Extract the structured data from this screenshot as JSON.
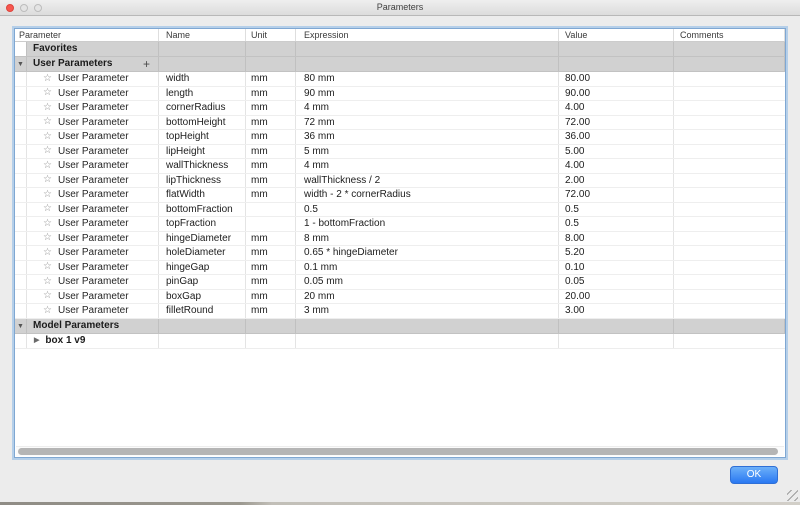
{
  "window": {
    "title": "Parameters"
  },
  "icons": {
    "favorite_star": "☆",
    "add": "+",
    "collapse": "▼",
    "expand": "▶"
  },
  "table": {
    "columns": [
      "Parameter",
      "Name",
      "Unit",
      "Expression",
      "Value",
      "Comments"
    ],
    "favorites": {
      "label": "Favorites"
    },
    "user_parameters": {
      "label": "User Parameters"
    },
    "rows": [
      {
        "parameter": "User Parameter",
        "name": "width",
        "unit": "mm",
        "expression": "80 mm",
        "value": "80.00",
        "comments": ""
      },
      {
        "parameter": "User Parameter",
        "name": "length",
        "unit": "mm",
        "expression": "90 mm",
        "value": "90.00",
        "comments": ""
      },
      {
        "parameter": "User Parameter",
        "name": "cornerRadius",
        "unit": "mm",
        "expression": "4 mm",
        "value": "4.00",
        "comments": ""
      },
      {
        "parameter": "User Parameter",
        "name": "bottomHeight",
        "unit": "mm",
        "expression": "72 mm",
        "value": "72.00",
        "comments": ""
      },
      {
        "parameter": "User Parameter",
        "name": "topHeight",
        "unit": "mm",
        "expression": "36 mm",
        "value": "36.00",
        "comments": ""
      },
      {
        "parameter": "User Parameter",
        "name": "lipHeight",
        "unit": "mm",
        "expression": "5 mm",
        "value": "5.00",
        "comments": ""
      },
      {
        "parameter": "User Parameter",
        "name": "wallThickness",
        "unit": "mm",
        "expression": "4 mm",
        "value": "4.00",
        "comments": ""
      },
      {
        "parameter": "User Parameter",
        "name": "lipThickness",
        "unit": "mm",
        "expression": "wallThickness / 2",
        "value": "2.00",
        "comments": ""
      },
      {
        "parameter": "User Parameter",
        "name": "flatWidth",
        "unit": "mm",
        "expression": "width - 2 * cornerRadius",
        "value": "72.00",
        "comments": ""
      },
      {
        "parameter": "User Parameter",
        "name": "bottomFraction",
        "unit": "",
        "expression": "0.5",
        "value": "0.5",
        "comments": ""
      },
      {
        "parameter": "User Parameter",
        "name": "topFraction",
        "unit": "",
        "expression": "1 - bottomFraction",
        "value": "0.5",
        "comments": ""
      },
      {
        "parameter": "User Parameter",
        "name": "hingeDiameter",
        "unit": "mm",
        "expression": "8 mm",
        "value": "8.00",
        "comments": ""
      },
      {
        "parameter": "User Parameter",
        "name": "holeDiameter",
        "unit": "mm",
        "expression": "0.65 * hingeDiameter",
        "value": "5.20",
        "comments": ""
      },
      {
        "parameter": "User Parameter",
        "name": "hingeGap",
        "unit": "mm",
        "expression": "0.1 mm",
        "value": "0.10",
        "comments": ""
      },
      {
        "parameter": "User Parameter",
        "name": "pinGap",
        "unit": "mm",
        "expression": "0.05 mm",
        "value": "0.05",
        "comments": ""
      },
      {
        "parameter": "User Parameter",
        "name": "boxGap",
        "unit": "mm",
        "expression": "20 mm",
        "value": "20.00",
        "comments": ""
      },
      {
        "parameter": "User Parameter",
        "name": "filletRound",
        "unit": "mm",
        "expression": "3 mm",
        "value": "3.00",
        "comments": ""
      }
    ],
    "model_parameters": {
      "label": "Model Parameters",
      "item_label": "box 1 v9"
    }
  },
  "footer": {
    "ok_label": "OK"
  },
  "colors": {
    "accent_blue": "#2a78f2",
    "focus_ring": "#b5cfe9",
    "section_gray": "#d1d1d1",
    "close_red": "#f7574f"
  }
}
